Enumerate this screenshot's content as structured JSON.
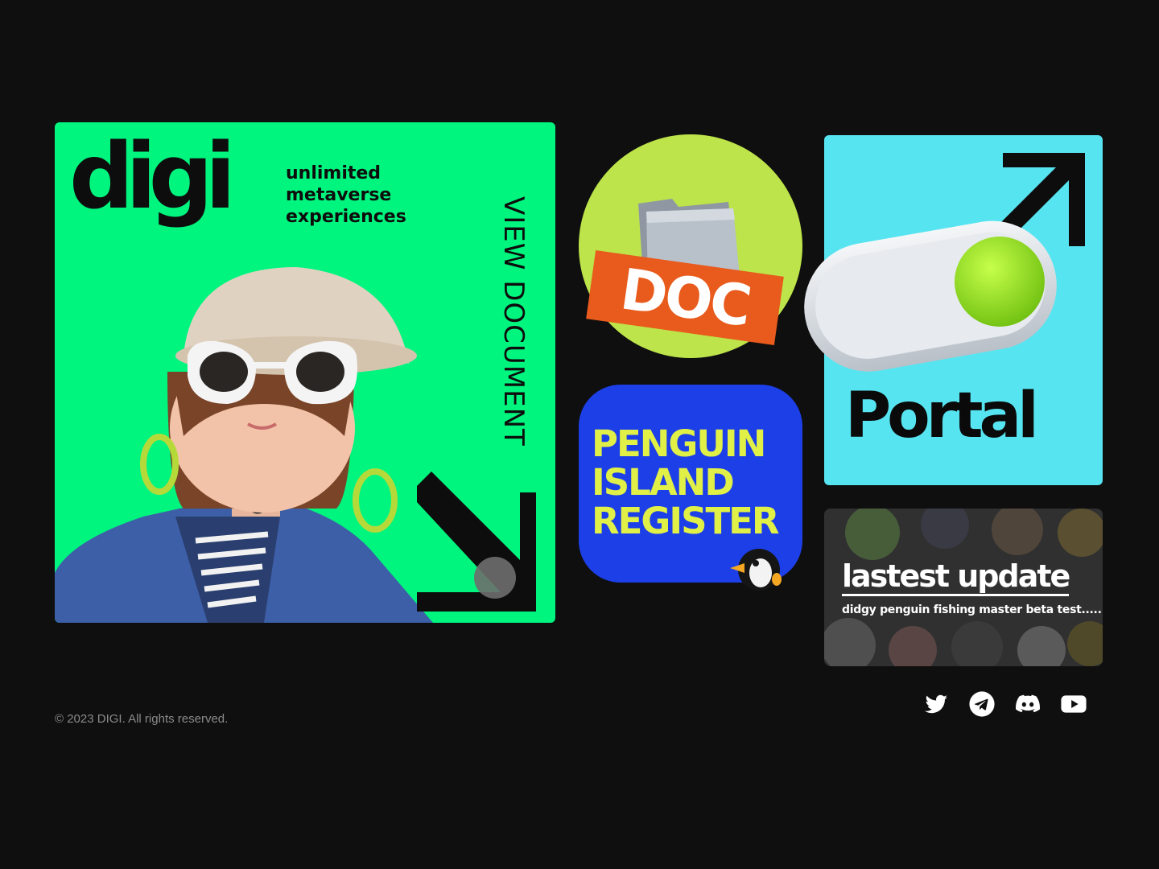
{
  "hero": {
    "logo_text": "digi",
    "tagline": [
      "unlimited",
      "metaverse",
      "experiences"
    ],
    "view_document_label": "VIEW DOCUMENT"
  },
  "doc_tile": {
    "label": "DOC"
  },
  "penguin_tile": {
    "lines": [
      "PENGUIN",
      "ISLAND",
      "REGISTER"
    ]
  },
  "portal_tile": {
    "label": "Portal"
  },
  "update_tile": {
    "title": "lastest update",
    "subtitle": "didgy penguin fishing master beta test....."
  },
  "footer": {
    "copyright": "© 2023 DIGI. All rights reserved.",
    "social": [
      "twitter-icon",
      "telegram-icon",
      "discord-icon",
      "youtube-icon"
    ]
  },
  "colors": {
    "background": "#0f0f0f",
    "hero_green": "#00f57e",
    "doc_lime": "#bde44a",
    "doc_orange": "#e85b1d",
    "penguin_blue": "#1c3fe8",
    "penguin_yellow": "#e0f046",
    "portal_cyan": "#57e4f1"
  }
}
